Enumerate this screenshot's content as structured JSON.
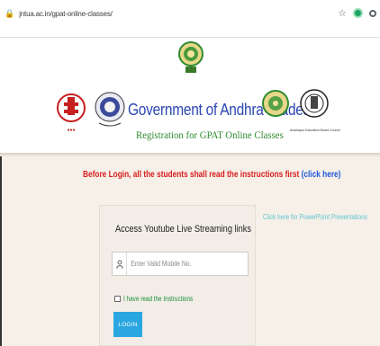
{
  "browser": {
    "url": "jntua.ac.in/gpat-online-classes/"
  },
  "header": {
    "title": "Government of Andhra Pradesh",
    "subtitle": "Registration for GPAT Online Classes",
    "logo_caption": "Anantapur Education Board Council"
  },
  "notice": {
    "text": "Before Login, all the students shall read the instructions first",
    "link_open": "(",
    "link_label": "click here",
    "link_close": ")"
  },
  "login_card": {
    "title": "Access Youtube Live Streaming links",
    "mobile_placeholder": "Enter Valid Mobile No.",
    "checkbox_label": "I have read the Instructions",
    "login_label": "LOGIN"
  },
  "side": {
    "ppt_link": "Click here for PowerPoint Presentations"
  },
  "colors": {
    "title": "#2c46b3",
    "subtitle": "#2f8b2f",
    "notice": "#d91e1e",
    "link": "#1e56d9",
    "button": "#2aa7e0",
    "background": "#f6f0e9"
  }
}
